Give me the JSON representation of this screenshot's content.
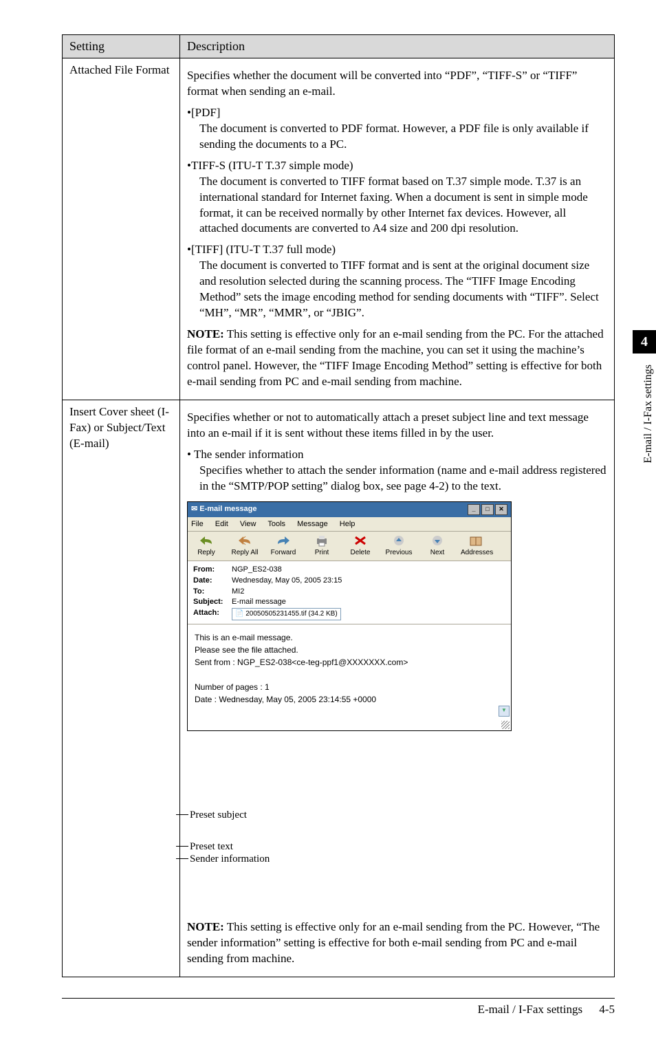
{
  "sidebar": {
    "chapter": "4",
    "label": "E-mail / I-Fax settings"
  },
  "table": {
    "head": {
      "setting": "Setting",
      "description": "Description"
    },
    "row1": {
      "setting": "Attached File Format",
      "intro": "Specifies whether the document will be converted into “PDF”, “TIFF-S” or “TIFF” format when sending an e-mail.",
      "b1_head": "•[PDF]",
      "b1_body": "The document is converted to PDF format. However, a PDF file is only available if sending the documents to a PC.",
      "b2_head": "•TIFF-S (ITU-T T.37 simple mode)",
      "b2_body": "The document is converted to TIFF format based on T.37 simple mode. T.37 is an international standard for Internet faxing. When a document is sent in simple mode format, it can be received normally by other Internet fax devices. However, all attached documents are converted to A4 size and 200 dpi resolution.",
      "b3_head": "•[TIFF] (ITU-T T.37 full mode)",
      "b3_body": "The document is converted to TIFF format and is sent at the original document size and resolution selected during the scanning process. The “TIFF Image Encoding Method” sets the image encoding method for sending documents with “TIFF”. Select “MH”, “MR”, “MMR”, or “JBIG”.",
      "note_label": "NOTE:",
      "note_body": "This setting is effective only for an e-mail sending from the PC. For the attached file format of an e-mail sending from the machine, you can set it using the machine’s control panel. However, the “TIFF Image Encoding Method” setting is effective for both e-mail sending from PC and e-mail sending from machine."
    },
    "row2": {
      "setting": "Insert Cover sheet (I-Fax) or Subject/Text (E-mail)",
      "intro": "Specifies whether or not to automatically attach a preset subject line and text message into an e-mail if it is sent without these items filled in by the user.",
      "sender_head": "• The sender information",
      "sender_body": "Specifies whether to attach the sender information (name and e-mail address registered in the “SMTP/POP setting” dialog box, see page 4-2) to the text.",
      "note_label": "NOTE:",
      "note_body": "This setting is effective only for an e-mail sending from the PC. However, “The sender information” setting is effective for both e-mail sending from PC and e-mail sending from machine."
    }
  },
  "email": {
    "title": "E-mail message",
    "menu": {
      "file": "File",
      "edit": "Edit",
      "view": "View",
      "tools": "Tools",
      "message": "Message",
      "help": "Help"
    },
    "toolbar": {
      "reply": "Reply",
      "replyall": "Reply All",
      "forward": "Forward",
      "print": "Print",
      "delete": "Delete",
      "previous": "Previous",
      "next": "Next",
      "addresses": "Addresses"
    },
    "headers": {
      "from_l": "From:",
      "from_v": "NGP_ES2-038",
      "date_l": "Date:",
      "date_v": "Wednesday, May 05, 2005 23:15",
      "to_l": "To:",
      "to_v": "MI2",
      "subj_l": "Subject:",
      "subj_v": "E-mail message",
      "att_l": "Attach:",
      "att_v": "20050505231455.tif (34.2 KB)"
    },
    "body": {
      "l1": "This is an e-mail message.",
      "l2": "Please see the file attached.",
      "l3": "Sent from    : NGP_ES2-038<ce-teg-ppf1@XXXXXXX.com>",
      "l4": "Number of pages : 1",
      "l5": "Date           : Wednesday, May 05, 2005 23:14:55 +0000"
    }
  },
  "callouts": {
    "preset_subject": "Preset subject",
    "preset_text": "Preset text",
    "sender_info": "Sender information"
  },
  "footer": {
    "title": "E-mail / I-Fax settings",
    "page": "4-5"
  }
}
